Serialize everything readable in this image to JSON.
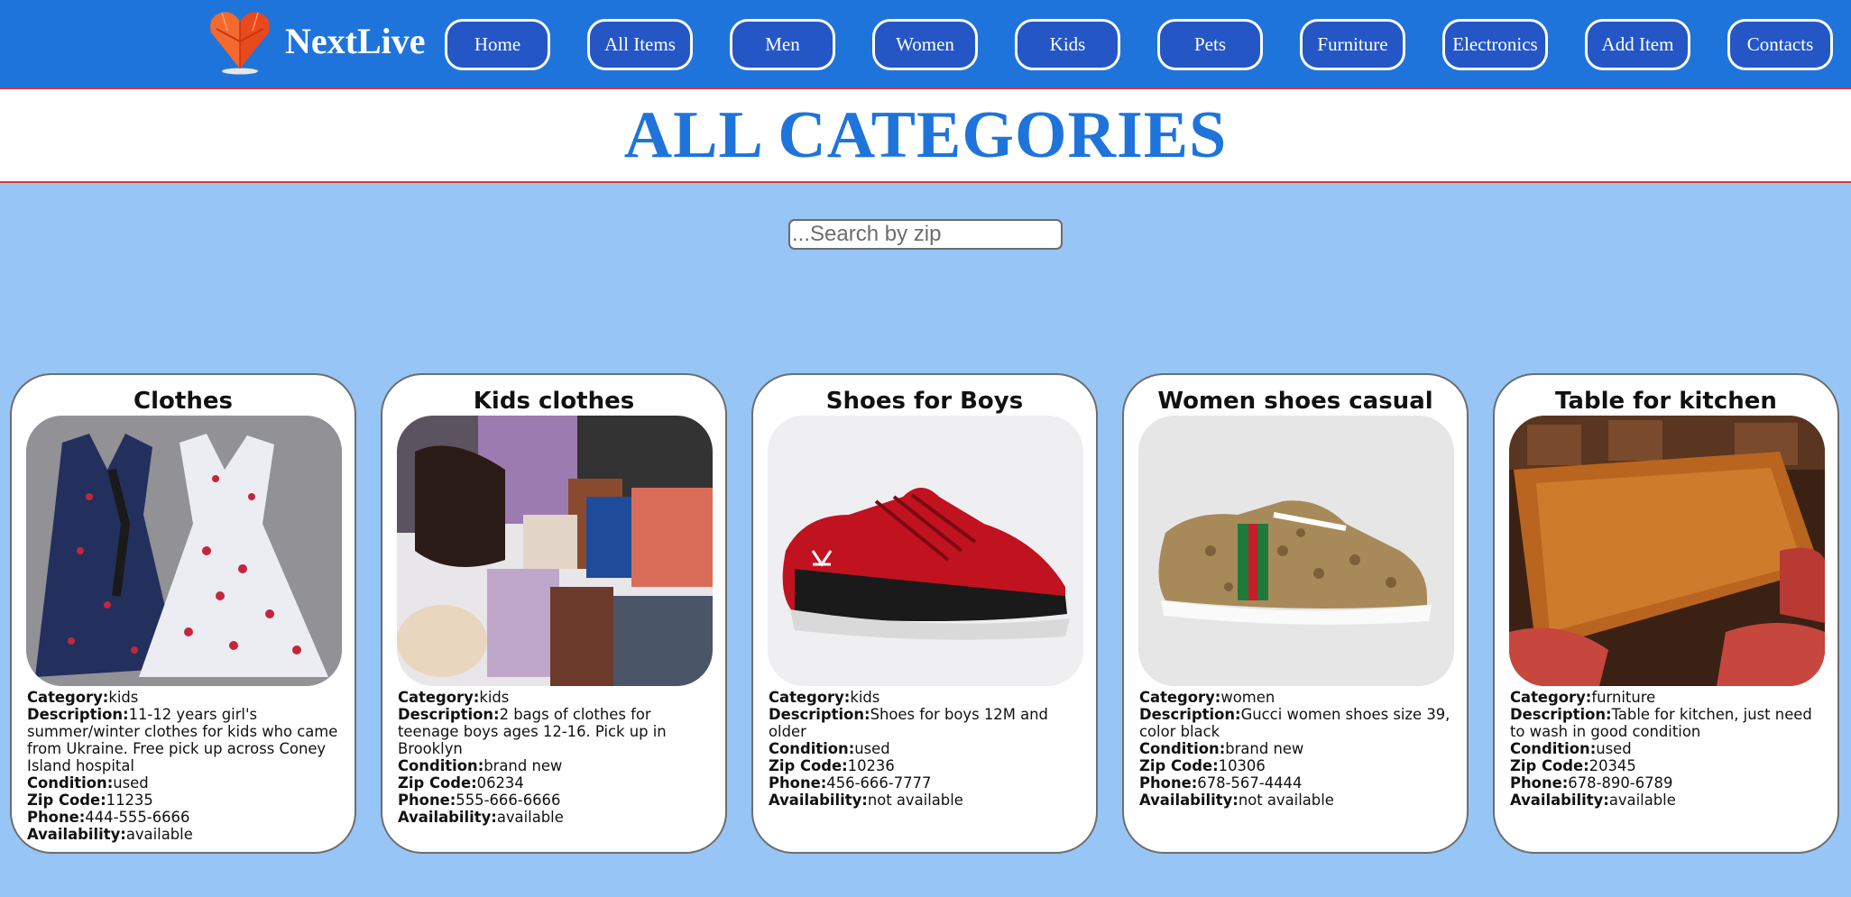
{
  "brand": {
    "name": "NextLive",
    "logo_icon": "heart-gem-icon"
  },
  "nav": [
    {
      "label": "Home"
    },
    {
      "label": "All Items"
    },
    {
      "label": "Men"
    },
    {
      "label": "Women"
    },
    {
      "label": "Kids"
    },
    {
      "label": "Pets"
    },
    {
      "label": "Furniture"
    },
    {
      "label": "Electronics"
    },
    {
      "label": "Add Item"
    },
    {
      "label": "Contacts"
    }
  ],
  "page": {
    "title": "ALL CATEGORIES"
  },
  "search": {
    "placeholder": "...Search by zip",
    "value": ""
  },
  "labels": {
    "category": "Category:",
    "description": "Description:",
    "condition": "Condition:",
    "zip": "Zip Code:",
    "phone": "Phone:",
    "availability": "Availability:"
  },
  "items": [
    {
      "title": "Clothes",
      "image": "two-dresses-photo",
      "category": "kids",
      "description": "11-12 years girl's summer/winter clothes for kids who came from Ukraine. Free pick up across Coney Island hospital",
      "condition": "used",
      "zip": "11235",
      "phone": "444-555-6666",
      "availability": "available"
    },
    {
      "title": "Kids clothes",
      "image": "clothes-pile-photo",
      "category": "kids",
      "description": "2 bags of clothes for teenage boys ages 12-16. Pick up in Brooklyn",
      "condition": "brand new",
      "zip": "06234",
      "phone": "555-666-6666",
      "availability": "available"
    },
    {
      "title": "Shoes for Boys",
      "image": "red-sneaker-photo",
      "category": "kids",
      "description": "Shoes for boys 12M and older",
      "condition": "used",
      "zip": "10236",
      "phone": "456-666-7777",
      "availability": "not available"
    },
    {
      "title": "Women shoes casual",
      "image": "gucci-sneaker-photo",
      "category": "women",
      "description": "Gucci women shoes size 39, color black",
      "condition": "brand new",
      "zip": "10306",
      "phone": "678-567-4444",
      "availability": "not available"
    },
    {
      "title": "Table for kitchen",
      "image": "wooden-table-photo",
      "category": "furniture",
      "description": "Table for kitchen, just need to wash in good condition",
      "condition": "used",
      "zip": "20345",
      "phone": "678-890-6789",
      "availability": "available"
    }
  ],
  "colors": {
    "header_bg": "#1f74dc",
    "nav_btn": "#2456c6",
    "page_bg": "#97c5f5",
    "accent_line": "#d23a3a"
  }
}
